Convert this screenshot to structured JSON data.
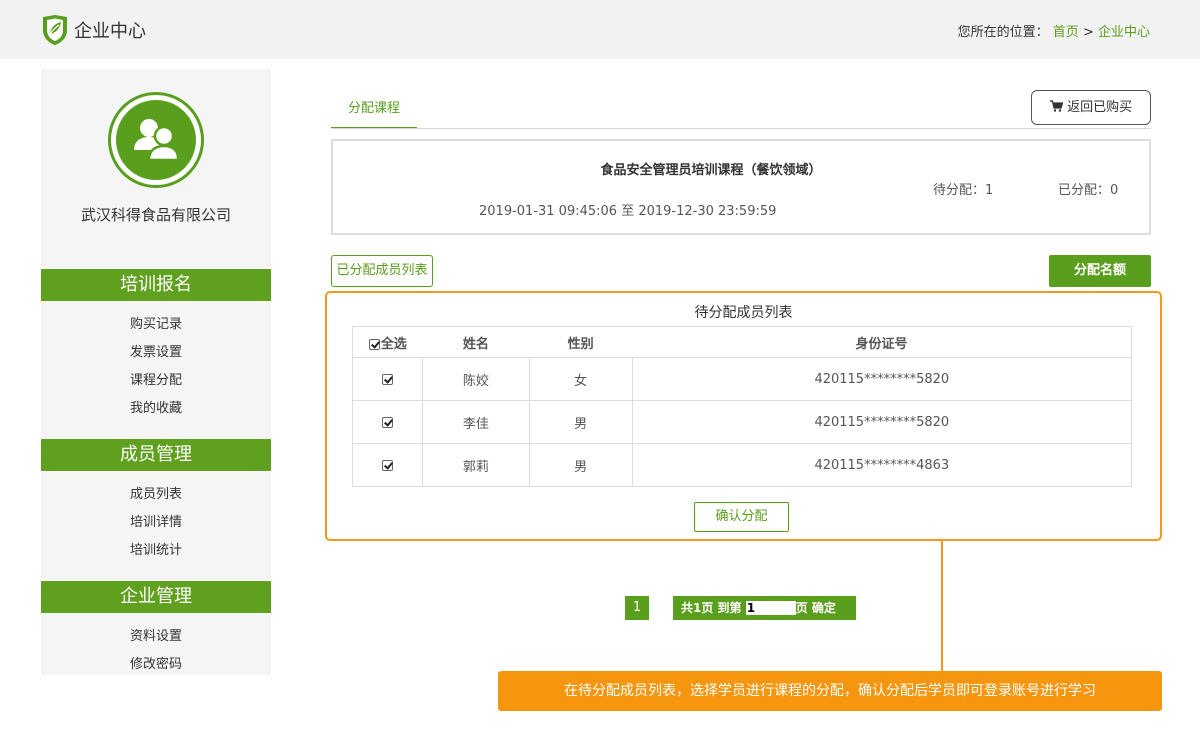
{
  "header": {
    "brand": "企业中心",
    "location_label": "您所在的位置：",
    "crumb_home": "首页",
    "crumb_sep": ">",
    "crumb_current": "企业中心"
  },
  "sidebar": {
    "company": "武汉科得食品有限公司",
    "sections": [
      {
        "title": "培训报名",
        "items": [
          "购买记录",
          "发票设置",
          "课程分配",
          "我的收藏"
        ]
      },
      {
        "title": "成员管理",
        "items": [
          "成员列表",
          "培训详情",
          "培训统计"
        ]
      },
      {
        "title": "企业管理",
        "items": [
          "资料设置",
          "修改密码"
        ]
      }
    ]
  },
  "main": {
    "tab": "分配课程",
    "back_button": "返回已购买",
    "course": {
      "title": "食品安全管理员培训课程（餐饮领域）",
      "date_range": "2019-01-31 09:45:06 至 2019-12-30 23:59:59",
      "pending": "待分配：1",
      "assigned": "已分配：0"
    },
    "assigned_list_button": "已分配成员列表",
    "quota_button": "分配名额",
    "pending_list": {
      "title": "待分配成员列表",
      "headers": {
        "select_all": "全选",
        "name": "姓名",
        "gender": "性别",
        "id": "身份证号"
      },
      "rows": [
        {
          "name": "陈姣",
          "gender": "女",
          "id": "420115********5820"
        },
        {
          "name": "李佳",
          "gender": "男",
          "id": "420115********5820"
        },
        {
          "name": "郭莉",
          "gender": "男",
          "id": "420115********4863"
        }
      ],
      "confirm_button": "确认分配"
    },
    "pagination": {
      "current_page": "1",
      "total_text": "共1页 到第",
      "input_value": "1",
      "page_suffix": "页",
      "ok": "确定"
    },
    "hint": "在待分配成员列表，选择学员进行课程的分配，确认分配后学员即可登录账号进行学习"
  },
  "colors": {
    "accent": "#5a9e1e",
    "highlight": "#f39a1e"
  }
}
